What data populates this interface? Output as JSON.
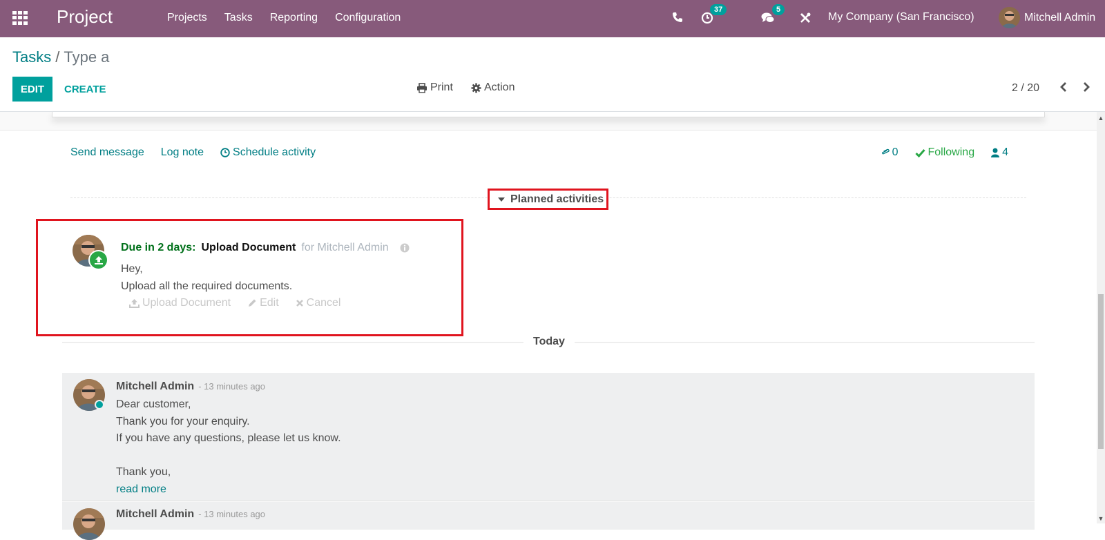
{
  "navbar": {
    "app_name": "Project",
    "menu": [
      "Projects",
      "Tasks",
      "Reporting",
      "Configuration"
    ],
    "activity_count": "37",
    "message_count": "5",
    "company": "My Company (San Francisco)",
    "user": "Mitchell Admin",
    "icons": [
      "apps-grid-icon",
      "phone-icon",
      "clock-icon",
      "comments-icon",
      "tools-icon"
    ],
    "color": "#875a7b"
  },
  "control_panel": {
    "breadcrumb": [
      "Tasks",
      "Type a"
    ],
    "edit_label": "EDIT",
    "create_label": "CREATE",
    "print_label": "Print",
    "action_label": "Action",
    "pager": "2 / 20"
  },
  "chatter": {
    "send_message": "Send message",
    "log_note": "Log note",
    "schedule_activity": "Schedule activity",
    "attachments_count": "0",
    "following": "Following",
    "followers_count": "4",
    "planned_activities_label": "Planned activities",
    "activity": {
      "due": "Due in 2 days:",
      "title": "Upload Document",
      "for": "for Mitchell Admin",
      "body": [
        "Hey,",
        "Upload all the required documents."
      ],
      "buttons": [
        "Upload Document",
        "Edit",
        "Cancel"
      ]
    },
    "date_separator": "Today",
    "messages": [
      {
        "author": "Mitchell Admin",
        "time": "- 13 minutes ago",
        "body": [
          "Dear customer,",
          "Thank you for your enquiry.",
          "If you have any questions, please let us know.",
          "",
          "Thank you,"
        ],
        "read_more": "read more"
      },
      {
        "author": "Mitchell Admin",
        "time": "- 13 minutes ago"
      }
    ]
  },
  "colors": {
    "accent": "#00a09d",
    "link": "#017e84",
    "success": "#28a745",
    "highlight_box": "#e0141e"
  }
}
